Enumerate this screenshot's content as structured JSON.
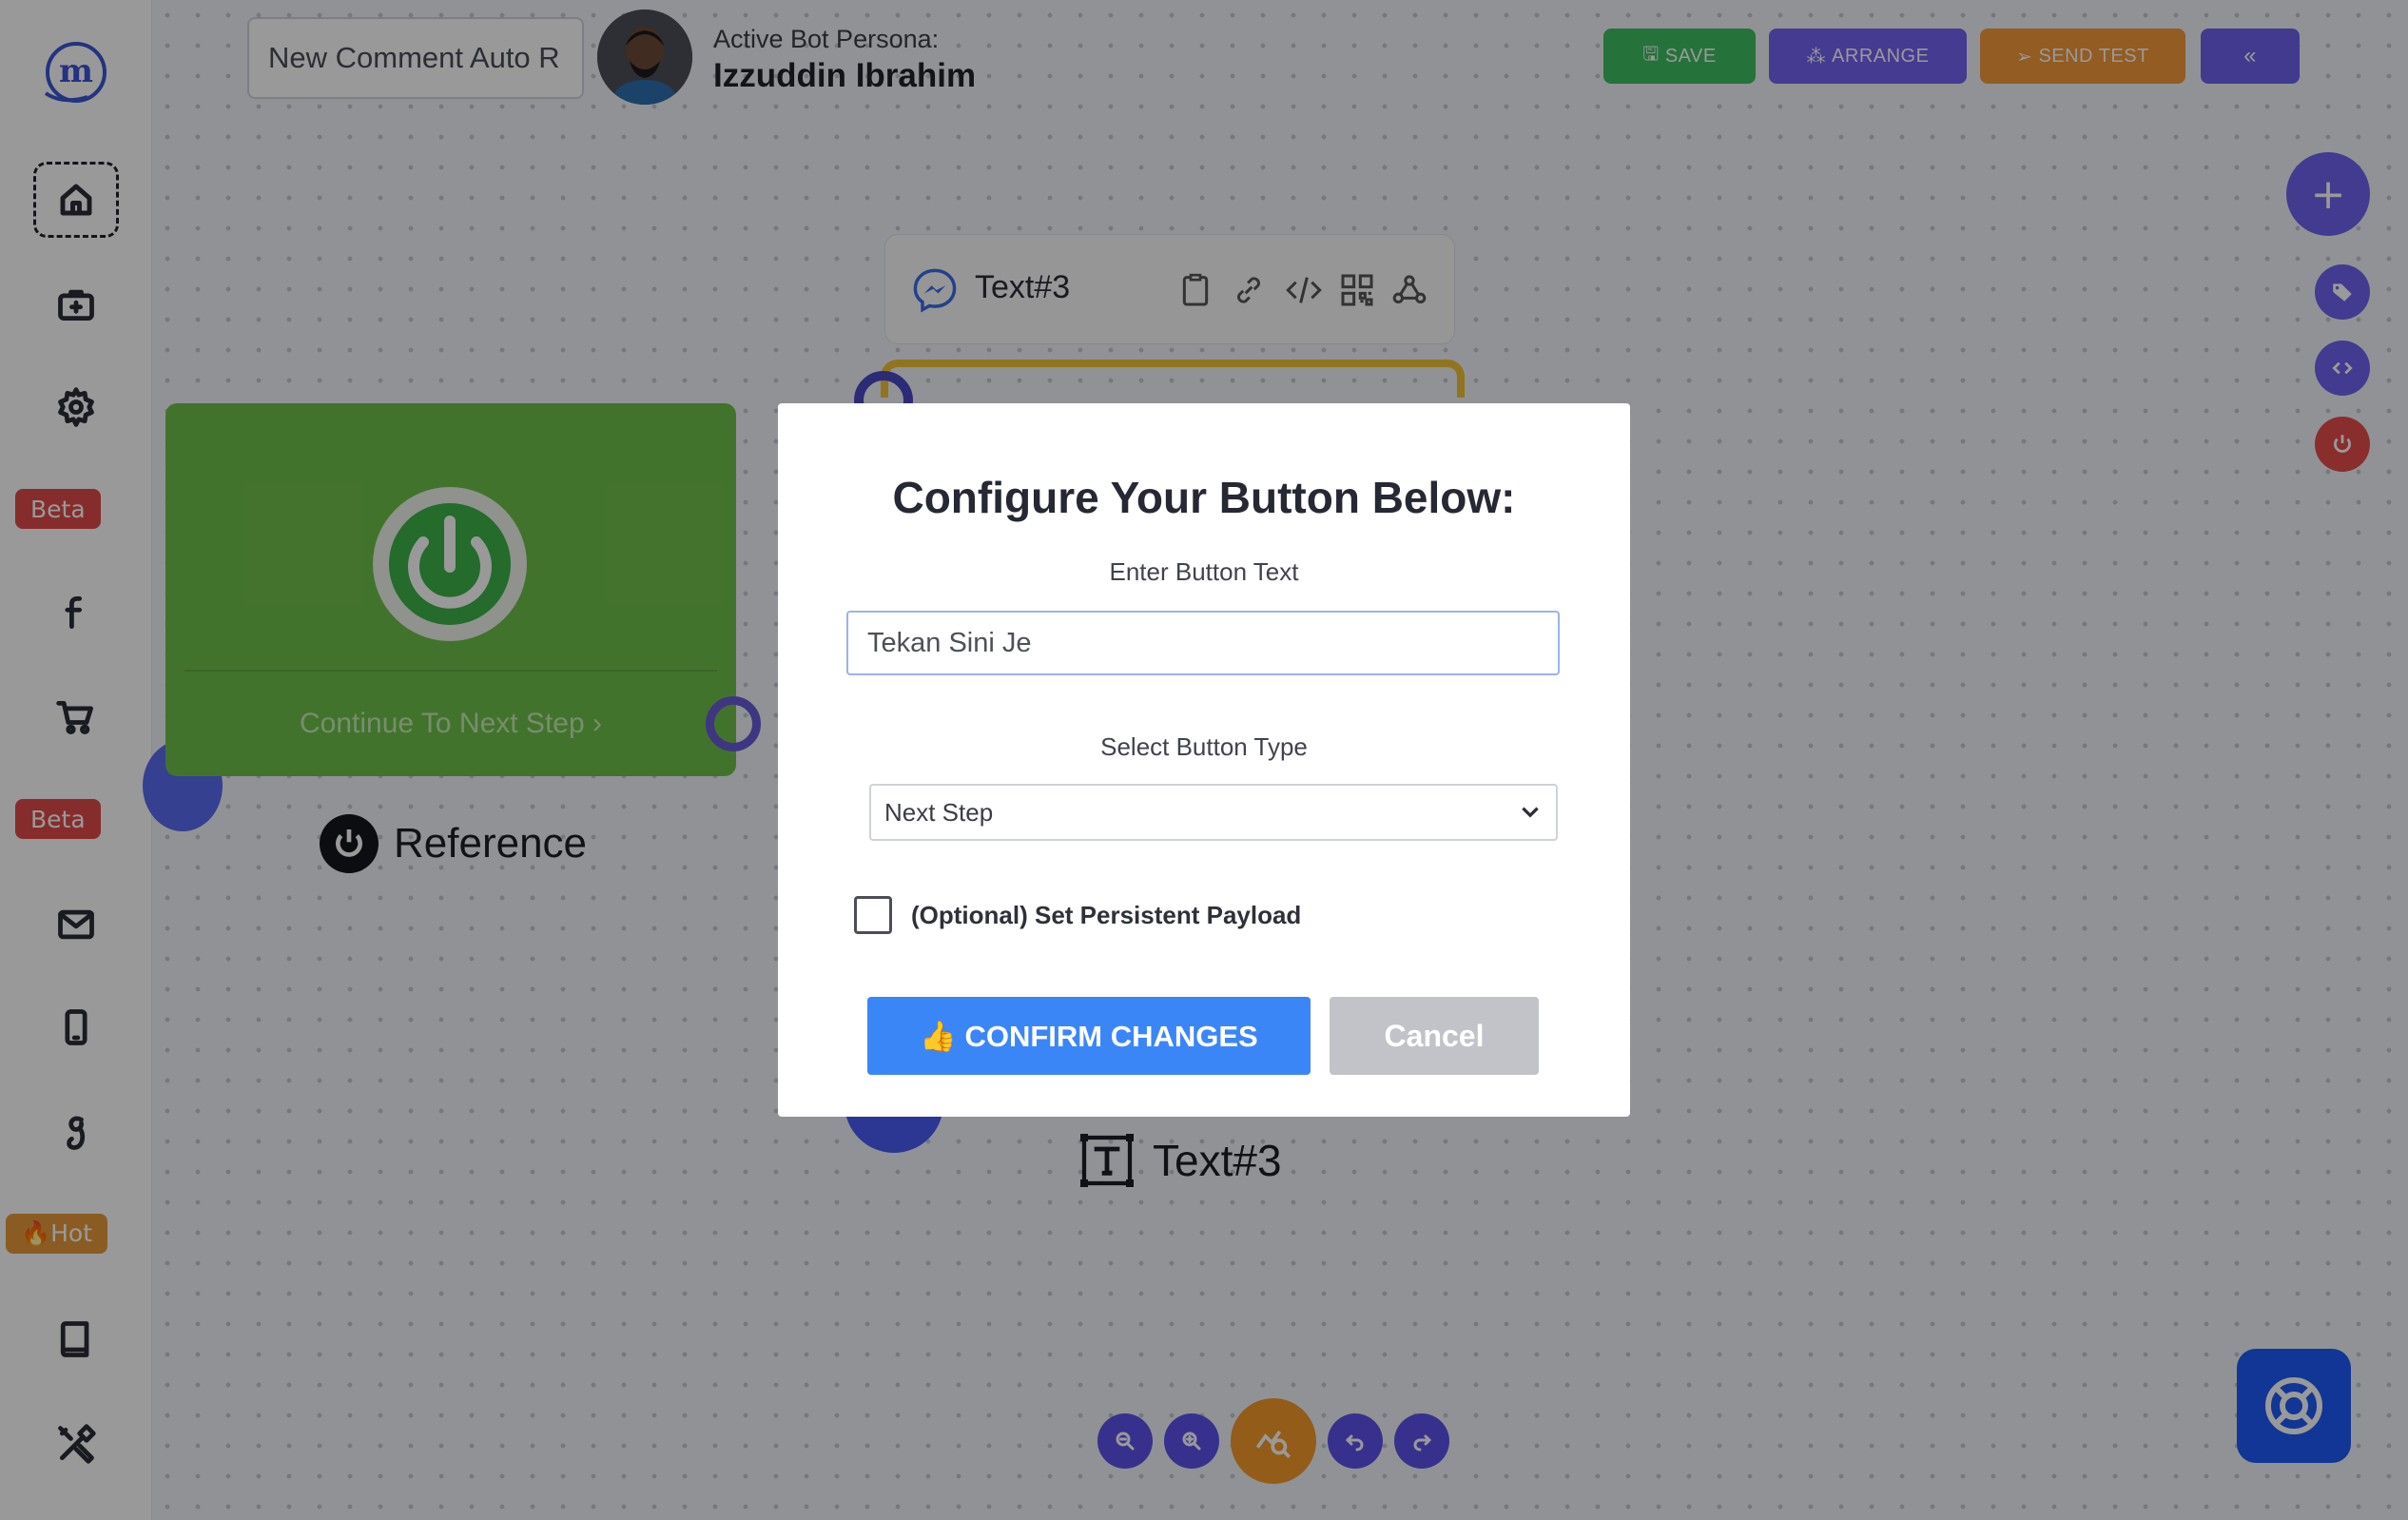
{
  "header": {
    "flow_name": "New Comment Auto R",
    "persona_caption": "Active Bot Persona:",
    "persona_name": "Izzuddin Ibrahim"
  },
  "toolbar": {
    "save_label": "SAVE",
    "arrange_label": "ARRANGE",
    "send_test_label": "SEND TEST",
    "collapse_label": "«"
  },
  "sidebar": {
    "items": [
      {
        "name": "home",
        "icon": "home-icon"
      },
      {
        "name": "briefcase",
        "icon": "briefcase-plus-icon"
      },
      {
        "name": "settings",
        "icon": "gear-icon"
      },
      {
        "name": "facebook",
        "icon": "facebook-icon"
      },
      {
        "name": "cart",
        "icon": "cart-icon"
      },
      {
        "name": "mail",
        "icon": "mail-icon"
      },
      {
        "name": "mobile",
        "icon": "mobile-icon"
      },
      {
        "name": "google",
        "icon": "google-icon"
      },
      {
        "name": "book",
        "icon": "book-icon"
      },
      {
        "name": "tools",
        "icon": "tools-icon"
      }
    ],
    "badges": {
      "beta_1": "Beta",
      "beta_2": "Beta",
      "hot": "🔥Hot"
    }
  },
  "canvas": {
    "start_node": {
      "next_label": "Continue To Next Step ›",
      "reference_label": "Reference"
    },
    "text_node": {
      "title": "Text#3",
      "label": "Text#3"
    }
  },
  "modal": {
    "title": "Configure Your Button Below:",
    "button_text_label": "Enter Button Text",
    "button_text_value": "Tekan Sini Je",
    "button_type_label": "Select Button Type",
    "button_type_value": "Next Step",
    "persistent_payload_label": "(Optional) Set Persistent Payload",
    "confirm_label": "👍 CONFIRM CHANGES",
    "cancel_label": "Cancel"
  },
  "colors": {
    "save": "#3fbf63",
    "arrange": "#7463f2",
    "send_test": "#f49a3b",
    "primary": "#6f63f0",
    "confirm": "#3b86f7",
    "start_node": "#6fc04a",
    "help": "#1f5af8"
  }
}
